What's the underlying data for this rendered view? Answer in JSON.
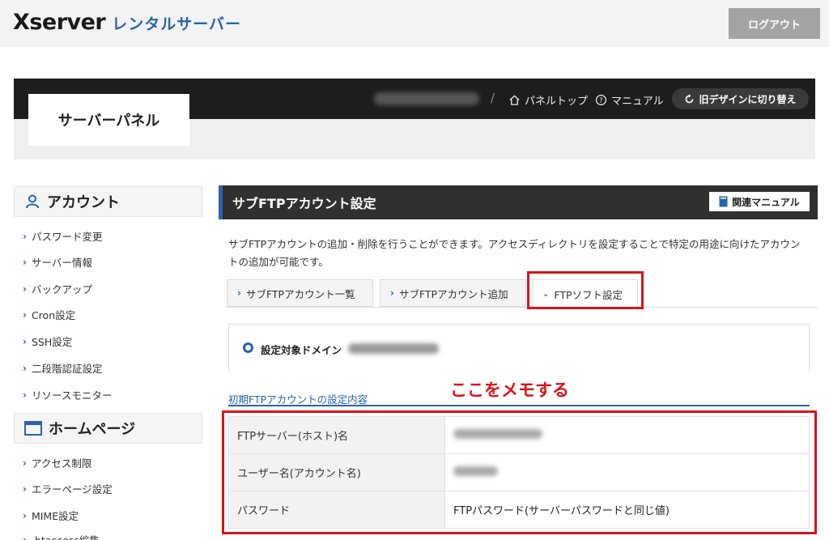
{
  "header": {
    "logo_main": "Xserver",
    "logo_sub": "レンタルサーバー",
    "logout_label": "ログアウト"
  },
  "panel": {
    "title": "サーバーパネル",
    "separator": "/",
    "nav": [
      {
        "label": "パネルトップ",
        "icon": "home-icon"
      },
      {
        "label": "マニュアル",
        "icon": "question-circle-icon"
      }
    ],
    "switch_label": "旧デザインに切り替え"
  },
  "sidebar": {
    "sections": [
      {
        "title": "アカウント",
        "icon": "user-icon",
        "items": [
          "パスワード変更",
          "サーバー情報",
          "バックアップ",
          "Cron設定",
          "SSH設定",
          "二段階認証設定",
          "リソースモニター"
        ]
      },
      {
        "title": "ホームページ",
        "icon": "window-icon",
        "items": [
          "アクセス制限",
          "エラーページ設定",
          "MIME設定",
          ".htaccess編集"
        ]
      }
    ]
  },
  "main": {
    "title": "サブFTPアカウント設定",
    "manual_label": "関連マニュアル",
    "description": "サブFTPアカウントの追加・削除を行うことができます。アクセスディレクトリを設定することで特定の用途に向けたアカウントの追加が可能です。",
    "tabs": [
      {
        "label": "サブFTPアカウント一覧",
        "active": false
      },
      {
        "label": "サブFTPアカウント追加",
        "active": false
      },
      {
        "label": "FTPソフト設定",
        "active": true
      }
    ],
    "domain_label": "設定対象ドメイン",
    "annotation": "ここをメモする",
    "section_title": "初期FTPアカウントの設定内容",
    "rows": [
      {
        "label": "FTPサーバー(ホスト)名",
        "value": ""
      },
      {
        "label": "ユーザー名(アカウント名)",
        "value": ""
      },
      {
        "label": "パスワード",
        "value": "FTPパスワード(サーバーパスワードと同じ値)"
      }
    ]
  },
  "colors": {
    "accent": "#2963ad",
    "highlight": "#d7141a",
    "dark": "#1d1d1d"
  }
}
